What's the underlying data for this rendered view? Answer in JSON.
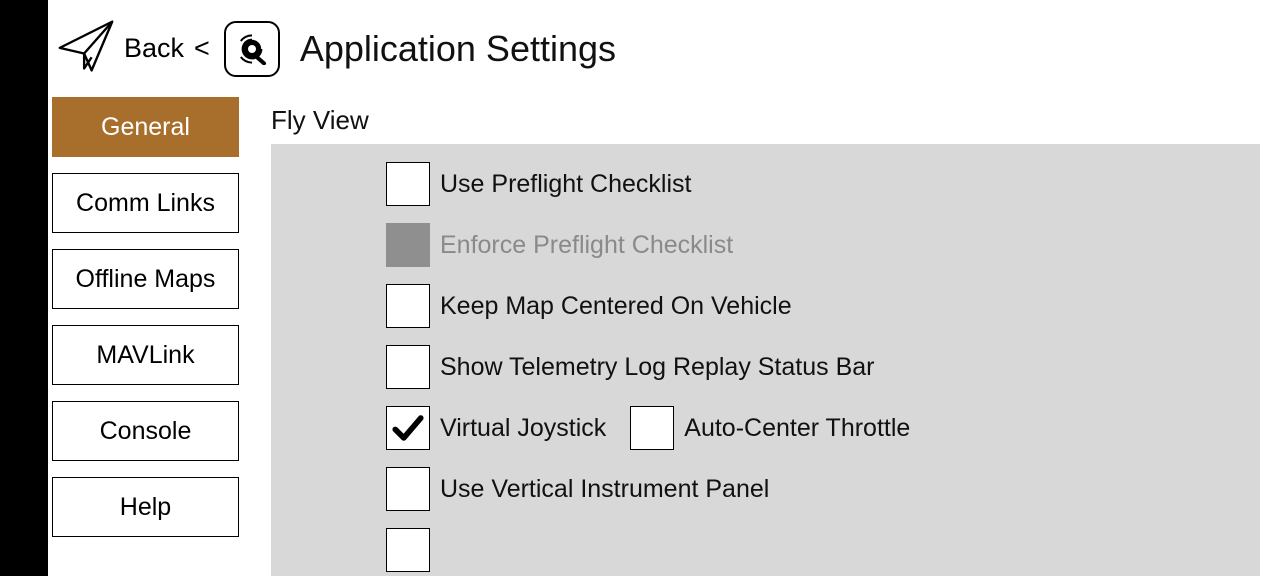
{
  "header": {
    "back_label": "Back",
    "page_title": "Application Settings"
  },
  "sidebar": {
    "items": [
      {
        "label": "General",
        "selected": true
      },
      {
        "label": "Comm Links",
        "selected": false
      },
      {
        "label": "Offline Maps",
        "selected": false
      },
      {
        "label": "MAVLink",
        "selected": false
      },
      {
        "label": "Console",
        "selected": false
      },
      {
        "label": "Help",
        "selected": false
      }
    ]
  },
  "content": {
    "section_title": "Fly View",
    "settings": {
      "use_preflight_checklist": {
        "label": "Use Preflight Checklist",
        "checked": false,
        "disabled": false
      },
      "enforce_preflight_checklist": {
        "label": "Enforce Preflight Checklist",
        "checked": false,
        "disabled": true
      },
      "keep_map_centered": {
        "label": "Keep Map Centered On Vehicle",
        "checked": false,
        "disabled": false
      },
      "show_telemetry_log_replay": {
        "label": "Show Telemetry Log Replay Status Bar",
        "checked": false,
        "disabled": false
      },
      "virtual_joystick": {
        "label": "Virtual Joystick",
        "checked": true,
        "disabled": false
      },
      "auto_center_throttle": {
        "label": "Auto-Center Throttle",
        "checked": false,
        "disabled": false
      },
      "use_vertical_instrument_panel": {
        "label": "Use Vertical Instrument Panel",
        "checked": false,
        "disabled": false
      }
    }
  }
}
